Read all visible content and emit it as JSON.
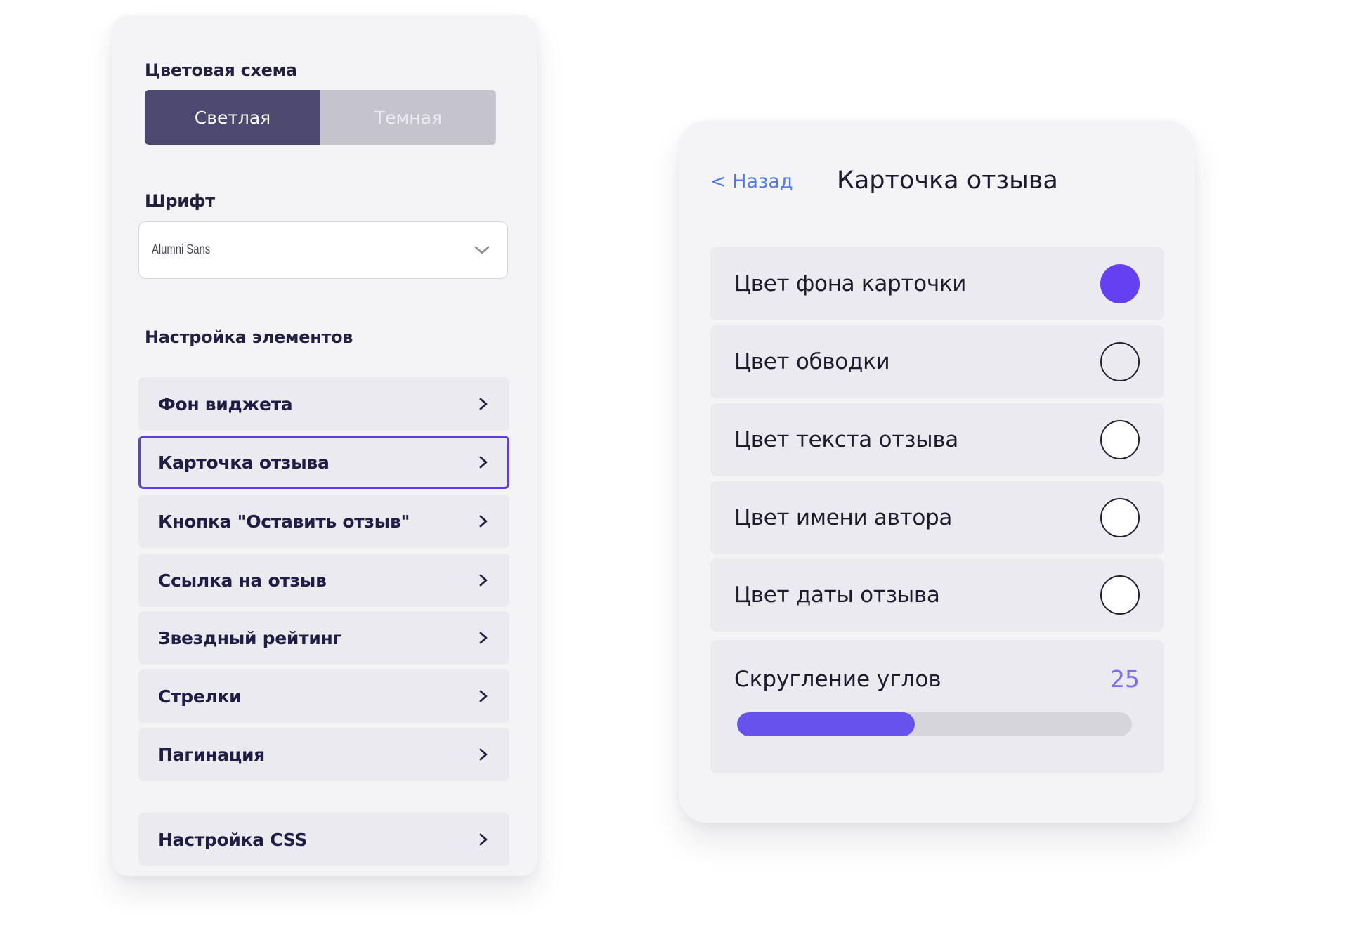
{
  "left_panel": {
    "color_scheme_title": "Цветовая схема",
    "theme_options": [
      {
        "label": "Светлая",
        "active": true
      },
      {
        "label": "Темная",
        "active": false
      }
    ],
    "font_title": "Шрифт",
    "font_select": {
      "value": "Alumni Sans"
    },
    "elements_title": "Настройка элементов",
    "items": [
      {
        "label": "Фон виджета",
        "selected": false
      },
      {
        "label": "Карточка отзыва",
        "selected": true
      },
      {
        "label": "Кнопка \"Оставить отзыв\"",
        "selected": false
      },
      {
        "label": "Ссылка на отзыв",
        "selected": false
      },
      {
        "label": "Звездный рейтинг",
        "selected": false
      },
      {
        "label": "Стрелки",
        "selected": false
      },
      {
        "label": "Пагинация",
        "selected": false
      }
    ],
    "css_item": {
      "label": "Настройка CSS"
    }
  },
  "right_panel": {
    "back_label": "< Назад",
    "title": "Карточка отзыва",
    "options": [
      {
        "label": "Цвет фона карточки",
        "color": "#6440f0"
      },
      {
        "label": "Цвет обводки",
        "color": "#ebebef"
      },
      {
        "label": "Цвет текста отзыва",
        "color": "#ffffff"
      },
      {
        "label": "Цвет имени автора",
        "color": "#ffffff"
      },
      {
        "label": "Цвет даты отзыва",
        "color": "#ffffff"
      }
    ],
    "corner_radius": {
      "label": "Скругление углов",
      "value": "25",
      "fill_fraction": 0.45
    }
  },
  "colors": {
    "accent": "#5f3ee0",
    "toggle_active": "#4c4870",
    "link": "#4f7bea",
    "slider_fill": "#6852ee"
  },
  "icons": {
    "menu_arrow": "chevron-right-icon",
    "select_arrow": "chevron-down-icon"
  }
}
